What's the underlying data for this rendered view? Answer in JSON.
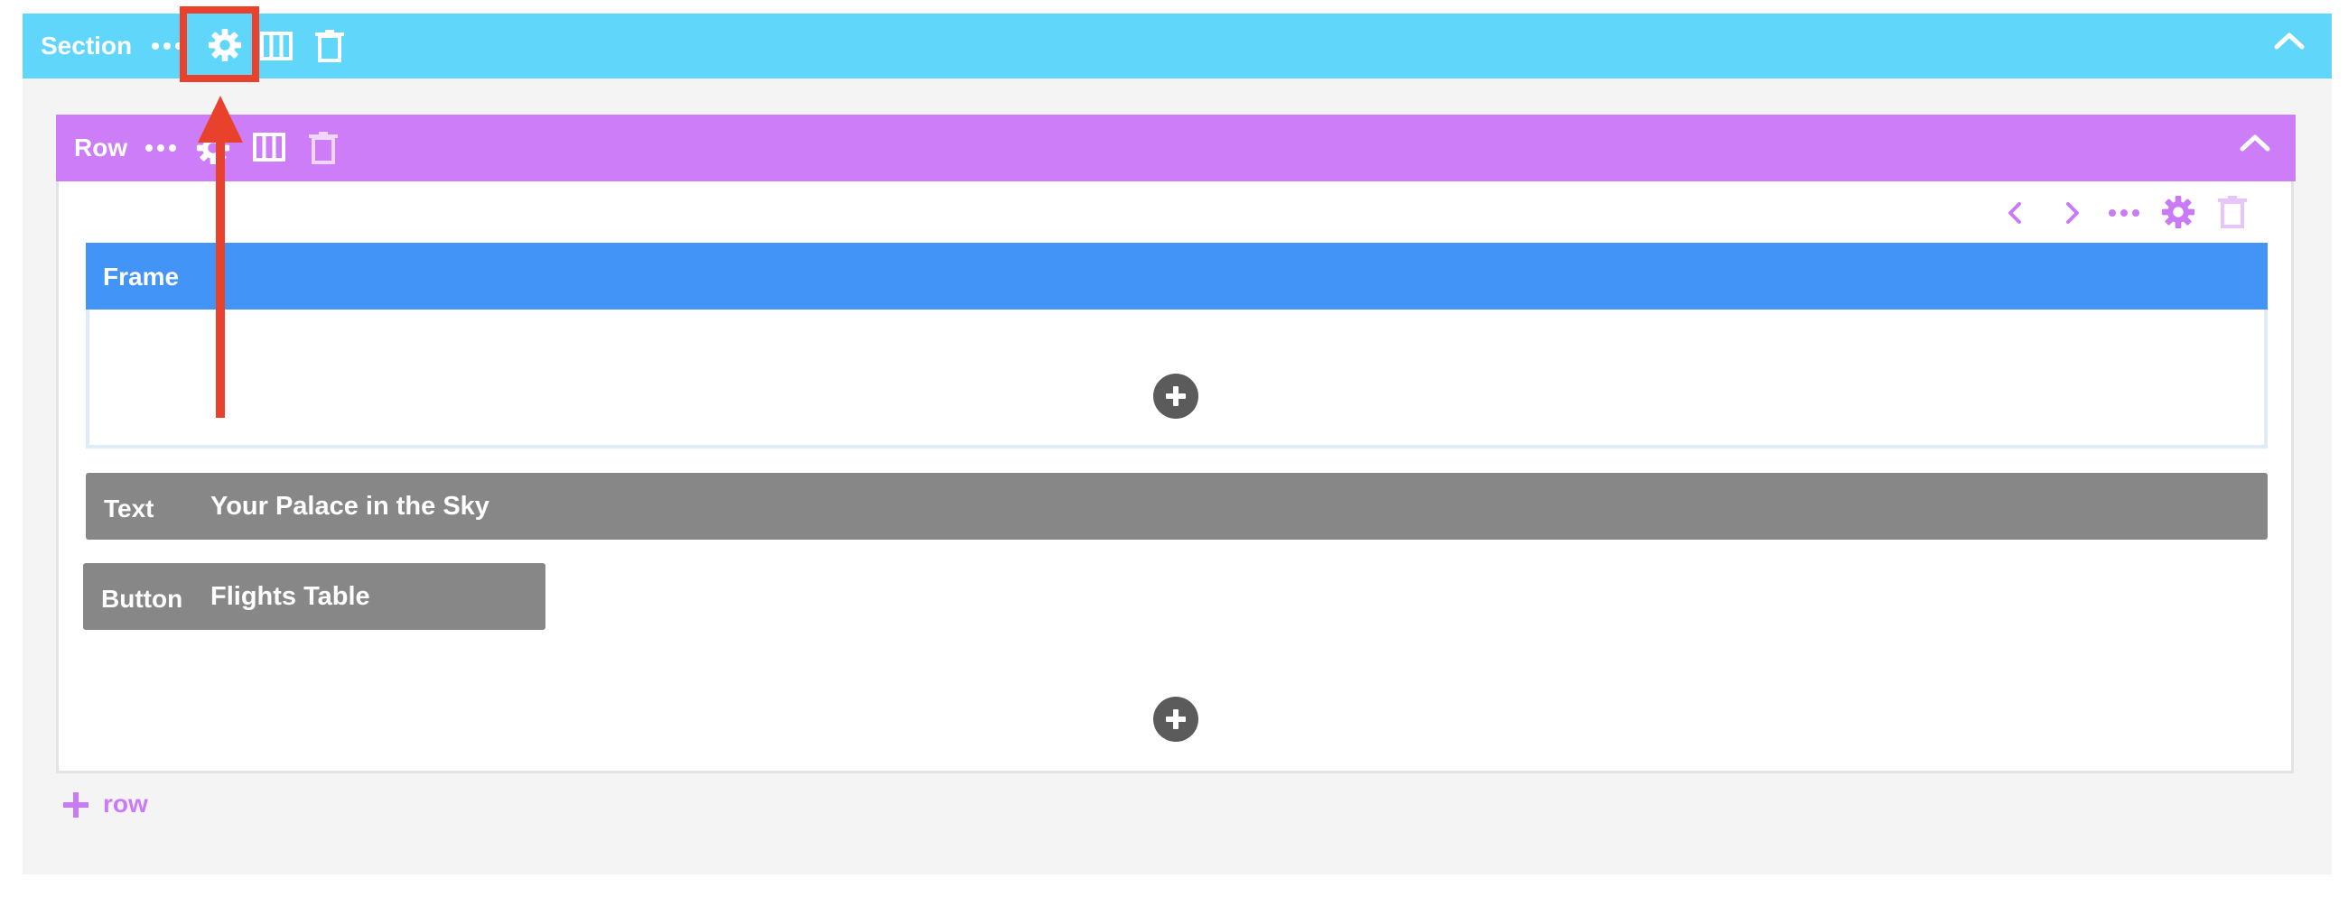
{
  "colors": {
    "section": "#61d6fb",
    "row": "#cd7df8",
    "frame": "#4294f7",
    "element": "#878787",
    "annotation": "#e8422c",
    "add_button": "#5b5b5b"
  },
  "section": {
    "label": "Section",
    "icons": [
      "more-icon",
      "gear-icon",
      "columns-icon",
      "trash-icon",
      "chevron-up-icon"
    ]
  },
  "row": {
    "label": "Row",
    "icons": [
      "more-icon",
      "gear-icon",
      "columns-icon",
      "trash-icon",
      "chevron-up-icon"
    ],
    "column_toolbar": [
      "chevron-left-icon",
      "chevron-right-icon",
      "more-icon",
      "gear-icon",
      "trash-icon"
    ]
  },
  "frame": {
    "label": "Frame"
  },
  "elements": [
    {
      "type": "Text",
      "title": "Your Palace in the Sky"
    },
    {
      "type": "Button",
      "title": "Flights Table"
    }
  ],
  "add_row": {
    "label": "row"
  },
  "annotation": {
    "target": "section-settings-gear-icon",
    "shape": "rectangle-with-arrow"
  }
}
